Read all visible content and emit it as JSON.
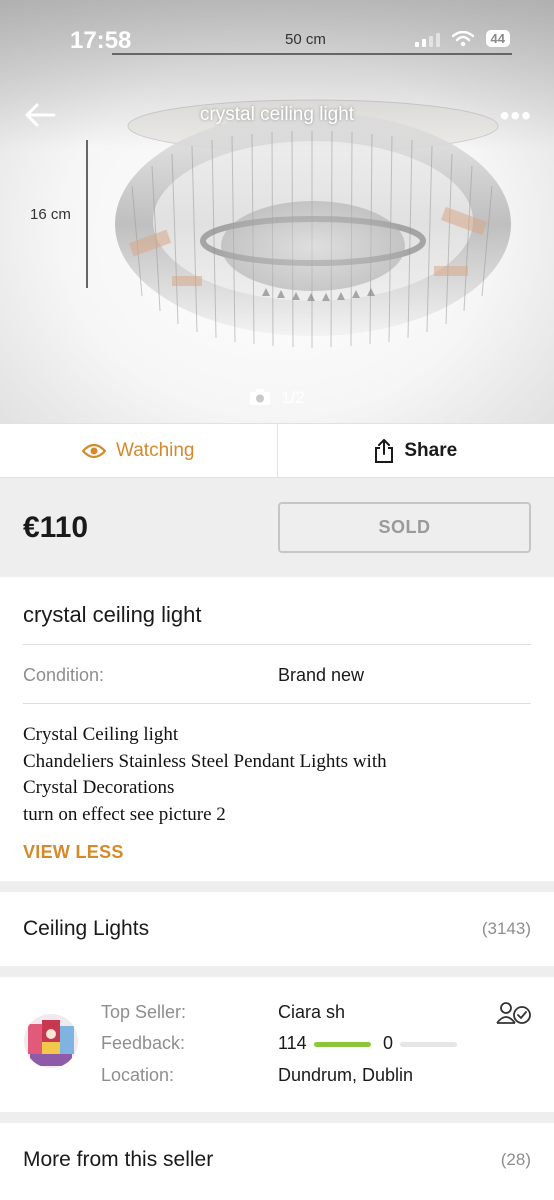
{
  "status_bar": {
    "time": "17:58",
    "battery": "44"
  },
  "hero": {
    "title": "crystal ceiling light",
    "dimension_width": "50 cm",
    "dimension_height": "16 cm",
    "photo_counter": "1/2",
    "photo_index": 1,
    "photo_total": 2
  },
  "actions": {
    "watch_label": "Watching",
    "share_label": "Share"
  },
  "price": {
    "amount": "€110",
    "status_button": "SOLD"
  },
  "details": {
    "title": "crystal ceiling light",
    "condition_label": "Condition:",
    "condition_value": "Brand new",
    "description_lines": [
      "Crystal Ceiling light",
      "Chandeliers Stainless Steel Pendant Lights with",
      "Crystal Decorations",
      "turn on effect see picture 2"
    ],
    "view_less_label": "VIEW LESS"
  },
  "category": {
    "label": "Ceiling Lights",
    "count": "(3143)"
  },
  "seller": {
    "top_seller_label": "Top Seller:",
    "top_seller_value": "Ciara sh",
    "feedback_label": "Feedback:",
    "feedback_positive": "114",
    "feedback_negative": "0",
    "feedback_positive_fraction": 1.0,
    "feedback_negative_fraction": 0.0,
    "location_label": "Location:",
    "location_value": "Dundrum, Dublin"
  },
  "more_from_seller": {
    "label": "More from this seller",
    "count": "(28)"
  },
  "colors": {
    "accent": "#d6892b",
    "positive": "#8cc63f",
    "muted": "#8e8e8e"
  },
  "icons": [
    "back-arrow-icon",
    "more-icon",
    "camera-icon",
    "eye-icon",
    "share-icon",
    "follow-seller-icon"
  ]
}
